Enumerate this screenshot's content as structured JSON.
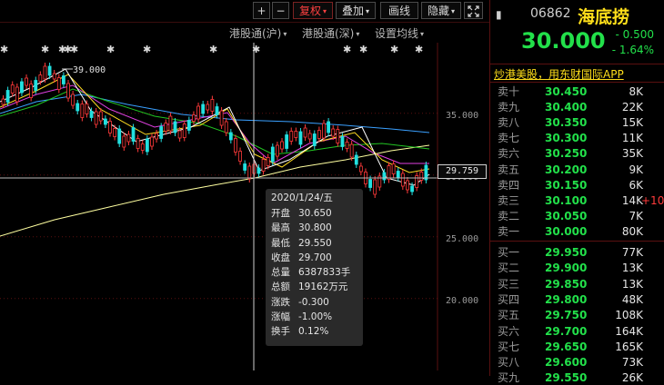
{
  "toolbar": {
    "plus": "+",
    "minus": "−",
    "adjust": "复权",
    "overlay": "叠加",
    "redraw": "画线",
    "hide": "隐藏",
    "caret": "▾"
  },
  "subbar": {
    "hk_connect_sh": "港股通(沪)",
    "hk_connect_sz": "港股通(深)",
    "ma_settings": "设置均线"
  },
  "chart": {
    "max_label": "39.000",
    "y_ticks": [
      "35.000",
      "30.000",
      "25.000",
      "20.000"
    ],
    "current_price": "29.759",
    "colors": {
      "up": "#ff3a3a",
      "down": "#22e0e0",
      "ma5": "#ffffff",
      "ma10": "#ffde22",
      "ma20": "#e040e0",
      "ma60": "#22c422",
      "ma120": "#3aa0ff",
      "ma250": "#ffffa0"
    }
  },
  "tooltip": {
    "date": "2020/1/24/五",
    "rows": [
      {
        "k": "开盘",
        "v": "30.650"
      },
      {
        "k": "最高",
        "v": "30.800"
      },
      {
        "k": "最低",
        "v": "29.550"
      },
      {
        "k": "收盘",
        "v": "29.700"
      },
      {
        "k": "总量",
        "v": "6387833手"
      },
      {
        "k": "总额",
        "v": "19162万元"
      },
      {
        "k": "涨跌",
        "v": "-0.300"
      },
      {
        "k": "涨幅",
        "v": "-1.00%"
      },
      {
        "k": "换手",
        "v": "0.12%"
      }
    ]
  },
  "quote": {
    "back": "▮",
    "code": "06862",
    "name": "海底捞",
    "price": "30.000",
    "change": "- 0.500",
    "change_pct": "- 1.64%",
    "price_color": "#22e04a"
  },
  "promo": "炒港美股，用东财国际APP",
  "orderbook": {
    "asks": [
      {
        "label": "卖十",
        "price": "30.450",
        "vol": "8K",
        "extra": ""
      },
      {
        "label": "卖九",
        "price": "30.400",
        "vol": "22K",
        "extra": ""
      },
      {
        "label": "卖八",
        "price": "30.350",
        "vol": "15K",
        "extra": ""
      },
      {
        "label": "卖七",
        "price": "30.300",
        "vol": "11K",
        "extra": ""
      },
      {
        "label": "卖六",
        "price": "30.250",
        "vol": "35K",
        "extra": ""
      },
      {
        "label": "卖五",
        "price": "30.200",
        "vol": "9K",
        "extra": ""
      },
      {
        "label": "卖四",
        "price": "30.150",
        "vol": "6K",
        "extra": ""
      },
      {
        "label": "卖三",
        "price": "30.100",
        "vol": "14K",
        "extra": "+100"
      },
      {
        "label": "卖二",
        "price": "30.050",
        "vol": "7K",
        "extra": ""
      },
      {
        "label": "卖一",
        "price": "30.000",
        "vol": "80K",
        "extra": ""
      }
    ],
    "bids": [
      {
        "label": "买一",
        "price": "29.950",
        "vol": "77K",
        "extra": ""
      },
      {
        "label": "买二",
        "price": "29.900",
        "vol": "13K",
        "extra": ""
      },
      {
        "label": "买三",
        "price": "29.850",
        "vol": "13K",
        "extra": ""
      },
      {
        "label": "买四",
        "price": "29.800",
        "vol": "48K",
        "extra": ""
      },
      {
        "label": "买五",
        "price": "29.750",
        "vol": "108K",
        "extra": ""
      },
      {
        "label": "买六",
        "price": "29.700",
        "vol": "164K",
        "extra": ""
      },
      {
        "label": "买七",
        "price": "29.650",
        "vol": "165K",
        "extra": ""
      },
      {
        "label": "买八",
        "price": "29.600",
        "vol": "73K",
        "extra": ""
      },
      {
        "label": "买九",
        "price": "29.550",
        "vol": "26K",
        "extra": ""
      }
    ]
  }
}
